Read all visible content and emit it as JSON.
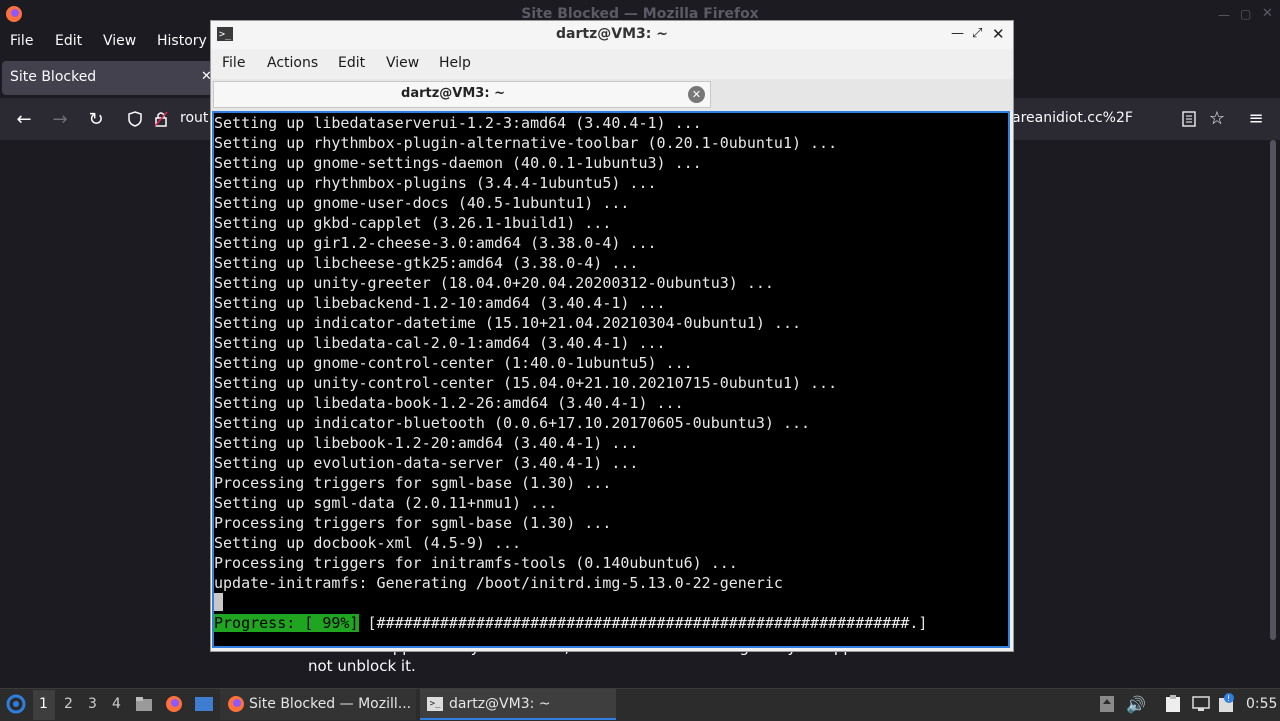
{
  "firefox": {
    "window_title": "Site Blocked — Mozilla Firefox",
    "menu": [
      "File",
      "Edit",
      "View",
      "History"
    ],
    "tab_title": "Site Blocked",
    "url_visible_left": "rout",
    "url_visible_right": "areanidiot.cc%2F",
    "page_text_line1": "Note that appeals may not matter, if the site is blocked rightfully an appeal will",
    "page_text_line2": "not unblock it."
  },
  "terminal": {
    "window_title": "dartz@VM3: ~",
    "menu": [
      "File",
      "Actions",
      "Edit",
      "View",
      "Help"
    ],
    "tab_label": "dartz@VM3: ~",
    "lines": [
      "Setting up libedataserverui-1.2-3:amd64 (3.40.4-1) ...",
      "Setting up rhythmbox-plugin-alternative-toolbar (0.20.1-0ubuntu1) ...",
      "Setting up gnome-settings-daemon (40.0.1-1ubuntu3) ...",
      "Setting up rhythmbox-plugins (3.4.4-1ubuntu5) ...",
      "Setting up gnome-user-docs (40.5-1ubuntu1) ...",
      "Setting up gkbd-capplet (3.26.1-1build1) ...",
      "Setting up gir1.2-cheese-3.0:amd64 (3.38.0-4) ...",
      "Setting up libcheese-gtk25:amd64 (3.38.0-4) ...",
      "Setting up unity-greeter (18.04.0+20.04.20200312-0ubuntu3) ...",
      "Setting up libebackend-1.2-10:amd64 (3.40.4-1) ...",
      "Setting up indicator-datetime (15.10+21.04.20210304-0ubuntu1) ...",
      "Setting up libedata-cal-2.0-1:amd64 (3.40.4-1) ...",
      "Setting up gnome-control-center (1:40.0-1ubuntu5) ...",
      "Setting up unity-control-center (15.04.0+21.10.20210715-0ubuntu1) ...",
      "Setting up libedata-book-1.2-26:amd64 (3.40.4-1) ...",
      "Setting up indicator-bluetooth (0.0.6+17.10.20170605-0ubuntu3) ...",
      "Setting up libebook-1.2-20:amd64 (3.40.4-1) ...",
      "Setting up evolution-data-server (3.40.4-1) ...",
      "Processing triggers for sgml-base (1.30) ...",
      "Setting up sgml-data (2.0.11+nmu1) ...",
      "Processing triggers for sgml-base (1.30) ...",
      "Setting up docbook-xml (4.5-9) ...",
      "Processing triggers for initramfs-tools (0.140ubuntu6) ...",
      "update-initramfs: Generating /boot/initrd.img-5.13.0-22-generic"
    ],
    "progress_label": "Progress: [ 99%]",
    "progress_bar": " [###########################################################.]",
    "progress_percent": 99
  },
  "taskbar": {
    "workspaces": [
      "1",
      "2",
      "3",
      "4"
    ],
    "task_firefox": "Site Blocked — Mozill...",
    "task_terminal": "dartz@VM3: ~",
    "clock": "0:55"
  }
}
